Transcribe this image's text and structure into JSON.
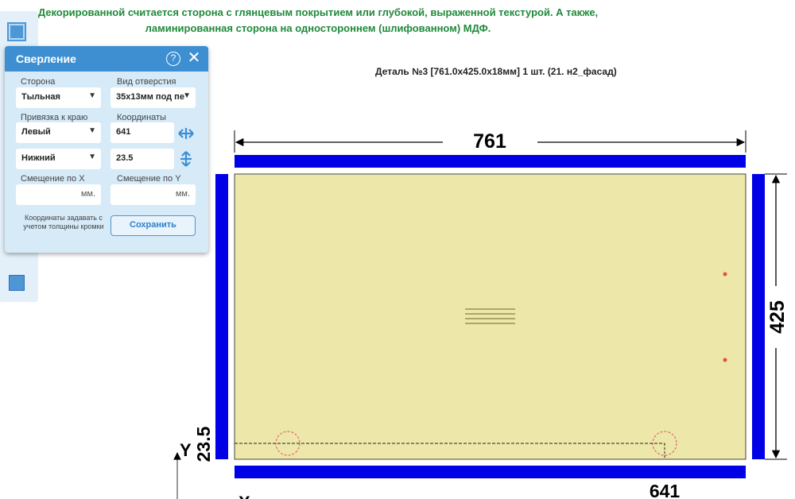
{
  "notice": {
    "line1": "Декорированной считается сторона с глянцевым покрытием или глубокой, выраженной текстурой. А также,",
    "line2": "ламинированная сторона на одностороннем (шлифованном) МДФ."
  },
  "part_title": "Деталь №3 [761.0x425.0x18мм] 1 шт. (21. н2_фасад)",
  "panel": {
    "title": "Сверление",
    "side_label": "Сторона",
    "side_value": "Тыльная",
    "hole_type_label": "Вид отверстия",
    "hole_type_value": "35x13мм под пе",
    "edge_anchor_label": "Привязка к краю",
    "anchor_x_value": "Левый",
    "anchor_y_value": "Нижний",
    "coords_label": "Координаты",
    "coord_x_value": "641",
    "coord_y_value": "23.5",
    "offset_x_label": "Смещение по X",
    "offset_y_label": "Смещение по Y",
    "unit": "мм.",
    "note": "Координаты задавать с учетом толщины кромки",
    "save_label": "Сохранить"
  },
  "drawing": {
    "width_dim": "761",
    "height_dim": "425",
    "hole_x_dim": "641",
    "hole_y_dim": "23.5",
    "axis_y": "Y",
    "axis_x": "X"
  },
  "colors": {
    "panel_fill": "#ede7a9",
    "edge_band": "#0000e6",
    "hole_marker": "#e84a4a",
    "header_blue": "#3d8fd1",
    "notice_green": "#1f8a3a"
  }
}
